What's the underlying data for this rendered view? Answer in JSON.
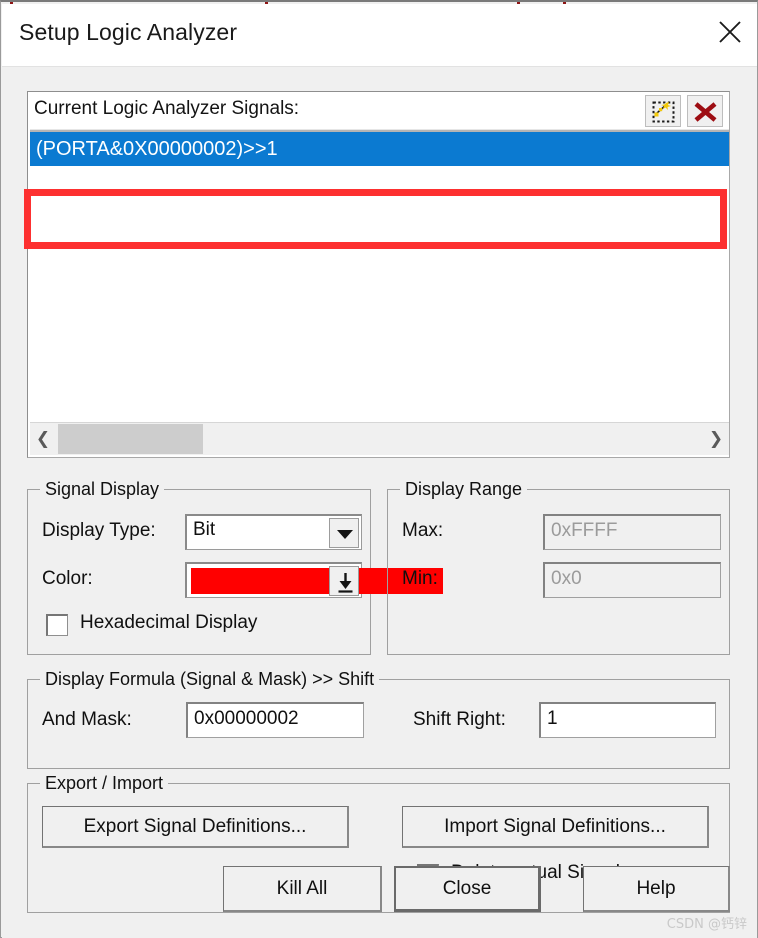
{
  "window": {
    "title": "Setup Logic Analyzer",
    "close_icon": "close-icon"
  },
  "signal_list": {
    "caption": "Current Logic Analyzer Signals:",
    "toolbar": {
      "new_icon": "magic-wand-new-signal-icon",
      "delete_icon": "red-x-delete-signal-icon"
    },
    "items": [
      {
        "text": "(PORTA&0X00000002)>>1",
        "selected": true
      }
    ],
    "scrollbar": {
      "left_arrow": "❮",
      "right_arrow": "❯"
    }
  },
  "signal_display": {
    "title": "Signal Display",
    "display_type_label": "Display Type:",
    "display_type_value": "Bit",
    "display_type_options": [
      "Bit"
    ],
    "color_label": "Color:",
    "color_value": "#ff0000",
    "hexadecimal_label": "Hexadecimal Display",
    "hexadecimal_checked": false
  },
  "display_range": {
    "title": "Display Range",
    "max_label": "Max:",
    "max_value": "0xFFFF",
    "min_label": "Min:",
    "min_value": "0x0",
    "disabled": true
  },
  "display_formula": {
    "title": "Display Formula (Signal & Mask) >> Shift",
    "and_mask_label": "And Mask:",
    "and_mask_value": "0x00000002",
    "shift_right_label": "Shift Right:",
    "shift_right_value": "1"
  },
  "export_import": {
    "title": "Export / Import",
    "export_button": "Export Signal Definitions...",
    "import_button": "Import Signal Definitions...",
    "delete_actual_label": "Delete actual Signals",
    "delete_actual_checked": false
  },
  "footer": {
    "kill_all": "Kill All",
    "close": "Close",
    "help": "Help"
  },
  "annotation": {
    "color": "#fd3030"
  },
  "watermark": {
    "text": "CSDN @钙锌"
  }
}
